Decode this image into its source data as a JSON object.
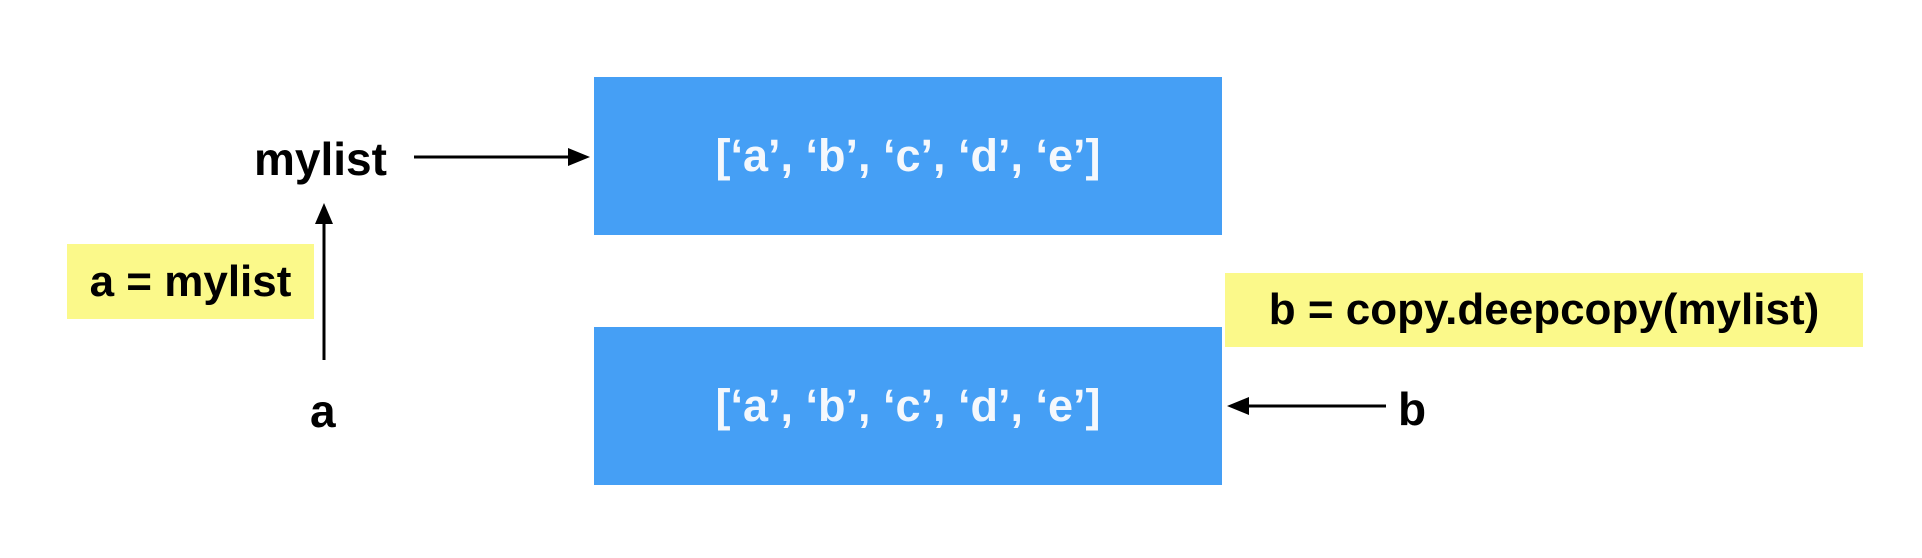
{
  "diagram": {
    "top_list": "[‘a’, ‘b’, ‘c’, ‘d’, ‘e’]",
    "bottom_list": "[‘a’, ‘b’, ‘c’, ‘d’, ‘e’]",
    "mylist_label": "mylist",
    "a_label": "a",
    "b_label": "b",
    "a_assignment": "a = mylist",
    "b_assignment": "b = copy.deepcopy(mylist)"
  },
  "colors": {
    "box_fill": "#459ff5",
    "box_text": "#f4f8fd",
    "highlight": "#fbf98a",
    "arrow": "#000000"
  }
}
